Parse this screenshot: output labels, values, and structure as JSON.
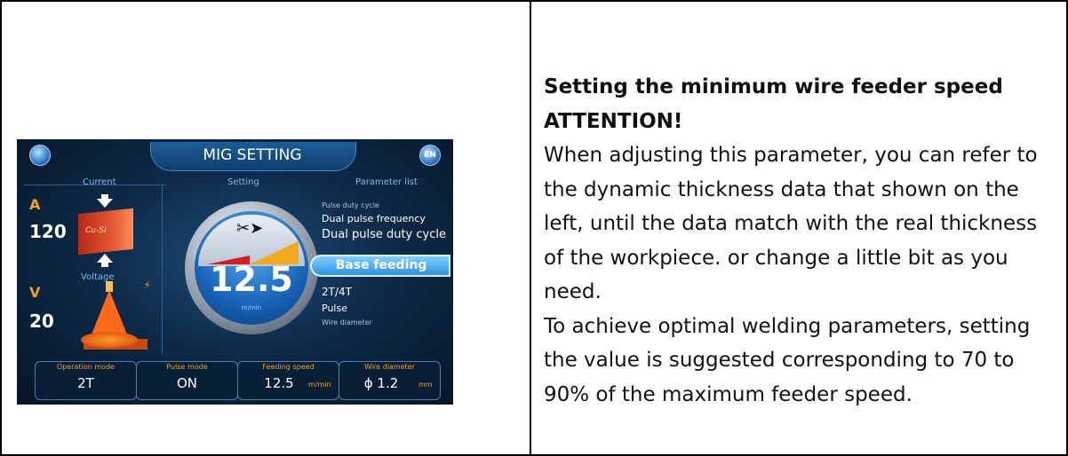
{
  "document": {
    "heading_line1": "Setting the minimum wire feeder speed",
    "heading_line2": "ATTENTION!",
    "para1": "When adjusting this parameter, you can refer to the dynamic thickness data that shown on the left, until the data match with the real thickness of the workpiece. or change a little bit as you need.",
    "para2": "To achieve optimal welding parameters, setting the value is suggested corresponding to 70 to 90% of the maximum feeder speed."
  },
  "screen": {
    "title": "MIG SETTING",
    "lang_button": "EN",
    "sections": {
      "current": "Current",
      "setting": "Setting",
      "parameter_list": "Parameter list",
      "voltage": "Voltage"
    },
    "current": {
      "unit": "A",
      "value": "120",
      "material": "Cu-Si"
    },
    "voltage": {
      "unit": "V",
      "value": "20"
    },
    "gauge": {
      "value": "12.5",
      "unit": "m/min"
    },
    "parameter_list": {
      "item1": "Pulse duty cycle",
      "item2": "Dual pulse frequency",
      "item3": "Dual pulse duty cycle",
      "selected": "Base feeding",
      "item5": "2T/4T",
      "item6": "Pulse",
      "item7": "Wire diameter"
    },
    "bottom": {
      "operation_mode_label": "Operation mode",
      "operation_mode_value": "2T",
      "pulse_mode_label": "Pulse mode",
      "pulse_mode_value": "ON",
      "feeding_speed_label": "Feeding speed",
      "feeding_speed_value": "12.5",
      "feeding_speed_unit": "m/min",
      "wire_diameter_label": "Wire diameter",
      "wire_diameter_value": "ϕ 1.2",
      "wire_diameter_unit": "mm"
    }
  },
  "colors": {
    "accent_orange": "#f3a21a",
    "screen_bg": "#0d2a48",
    "highlight_blue": "#2f91e2"
  }
}
